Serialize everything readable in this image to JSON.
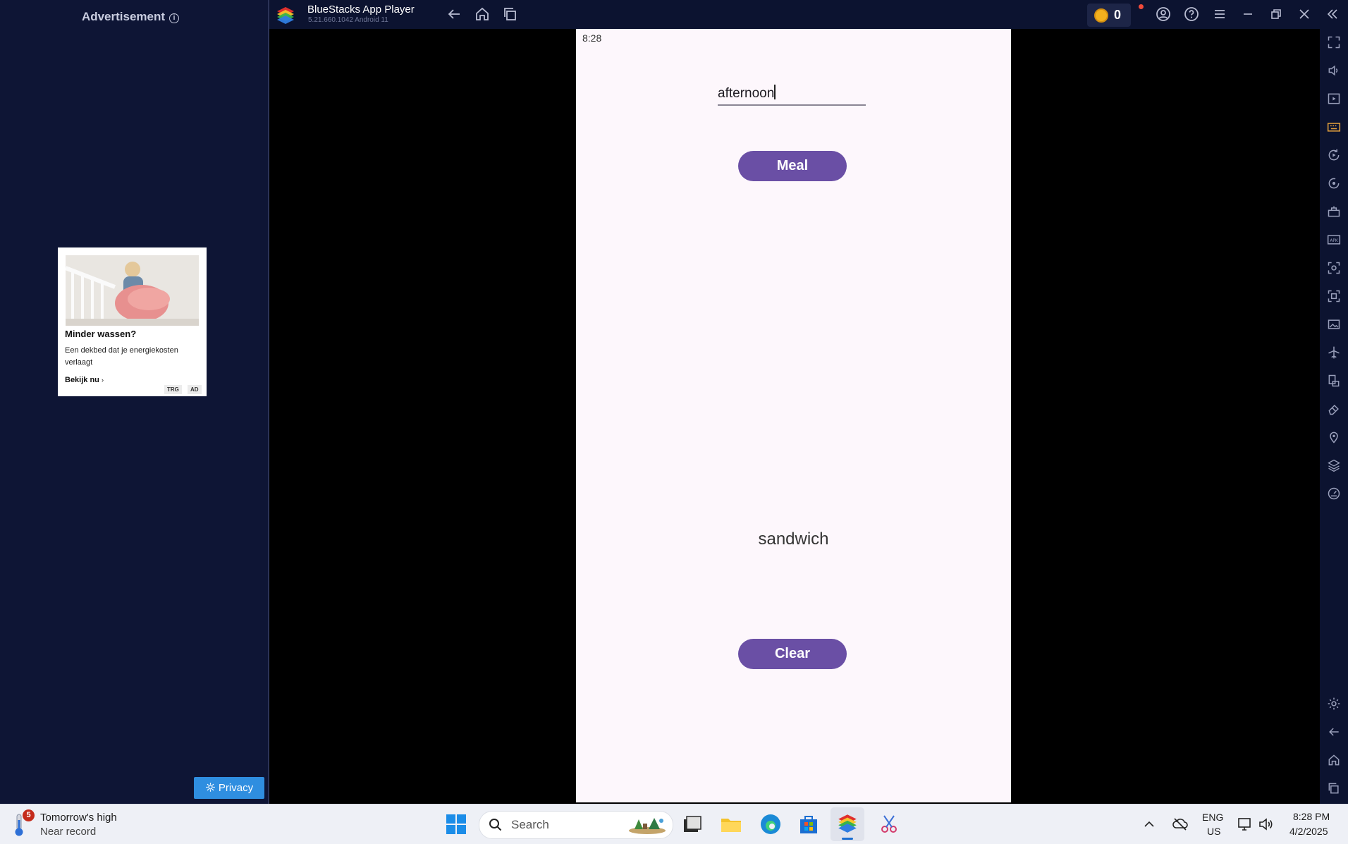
{
  "ad_panel": {
    "heading": "Advertisement",
    "card": {
      "title": "Minder wassen?",
      "description": "Een dekbed dat je energiekosten verlaagt",
      "cta": "Bekijk nu",
      "tags": [
        "TRG",
        "AD"
      ]
    },
    "privacy_label": "Privacy"
  },
  "titlebar": {
    "app_title": "BlueStacks App Player",
    "version": "5.21.660.1042  Android 11",
    "coin_count": "0",
    "icons": [
      "back-icon",
      "home-icon",
      "recent-apps-icon",
      "account-icon",
      "help-icon",
      "menu-icon",
      "minimize-icon",
      "restore-icon",
      "close-icon",
      "collapse-sidebar-icon"
    ]
  },
  "phone": {
    "status_time": "8:28",
    "input_value": "afternoon",
    "meal_button": "Meal",
    "result_text": "sandwich",
    "clear_button": "Clear",
    "accent_color": "#6a4fa5",
    "background_color": "#fdf7fc"
  },
  "right_sidebar": {
    "icons": [
      "fullscreen-icon",
      "volume-icon",
      "media-icon",
      "keyboard-icon",
      "rotate-icon",
      "sync-icon",
      "macro-icon",
      "apk-icon",
      "screenshot-icon",
      "resize-icon",
      "gallery-icon",
      "airplane-icon",
      "multi-instance-icon",
      "eraser-icon",
      "location-icon",
      "layers-icon",
      "performance-icon",
      "settings-icon",
      "back-icon",
      "home-icon",
      "recent-apps-icon"
    ]
  },
  "taskbar": {
    "weather_badge": "5",
    "weather_title": "Tomorrow's high",
    "weather_subtitle": "Near record",
    "search_placeholder": "Search",
    "lang_line1": "ENG",
    "lang_line2": "US",
    "time": "8:28 PM",
    "date": "4/2/2025"
  }
}
